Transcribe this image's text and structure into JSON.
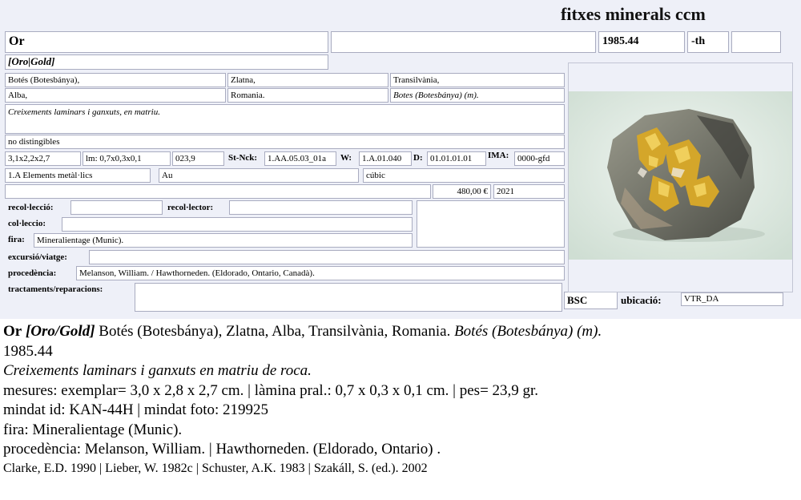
{
  "card": {
    "brand": "fitxes minerals ccm",
    "name": "Or",
    "catalog": "1985.44",
    "suffix": "-th",
    "synonyms": "[Oro|Gold]",
    "loc1": "Botés (Botesbánya),",
    "loc2": "Zlatna,",
    "loc3": "Transilvània,",
    "loc4": "Alba,",
    "loc5": "Romania.",
    "loc6": "Botes (Botesbánya) (m).",
    "description": "Creixements laminars i ganxuts, en matriu.",
    "note": "no distingibles",
    "size": "3,1x2,2x2,7",
    "lamina": "lm: 0,7x0,3x0,1",
    "weight": "023,9",
    "stnck_label": "St-Nck:",
    "stnck": "1.AA.05.03_01a",
    "w_label": "W:",
    "w": "1.A.01.040",
    "d_label": "D:",
    "d": "01.01.01.01",
    "ima_label": "IMA:",
    "ima": "0000-gfd",
    "class": "1.A Elements metàl·lics",
    "formula": "Au",
    "system": "cúbic",
    "price": "480,00 €",
    "year": "2021",
    "recoleccio_label": "recol·lecció:",
    "recolector_label": "recol·lector:",
    "colleccio_label": "col·leccio:",
    "fira_label": "fira:",
    "fira": "Mineralientage (Munic).",
    "excursio_label": "excursió/viatge:",
    "procedencia_label": "procedència:",
    "procedencia": "Melanson, William. / Hawthorneden. (Eldorado, Ontario, Canadà).",
    "tractaments_label": "tractaments/reparacions:",
    "bsc": "BSC",
    "ubicacio_label": "ubicació:",
    "ubicacio": "VTR_DA"
  },
  "summary": {
    "name": "Or",
    "synonyms": "[Oro/Gold]",
    "locality": "Botés (Botesbánya), Zlatna, Alba, Transilvània, Romania.",
    "mine": "Botés (Botesbánya) (m).",
    "catalog": "1985.44",
    "description": "Creixements laminars i ganxuts en matriu de roca.",
    "measures": "mesures: exemplar= 3,0 x 2,8 x 2,7 cm. | làmina pral.: 0,7 x 0,3 x 0,1 cm. | pes= 23,9 gr.",
    "mindat": "mindat id: KAN-44H | mindat foto: 219925",
    "fira": "fira: Mineralientage (Munic).",
    "procedencia": "procedència: Melanson, William. | Hawthorneden. (Eldorado, Ontario) .",
    "refs": "Clarke, E.D. 1990 | Lieber, W. 1982c | Schuster, A.K. 1983 | Szakáll, S. (ed.). 2002"
  },
  "photo": {
    "subject": "gold-specimen-photo",
    "background": "#dfe9e0"
  }
}
